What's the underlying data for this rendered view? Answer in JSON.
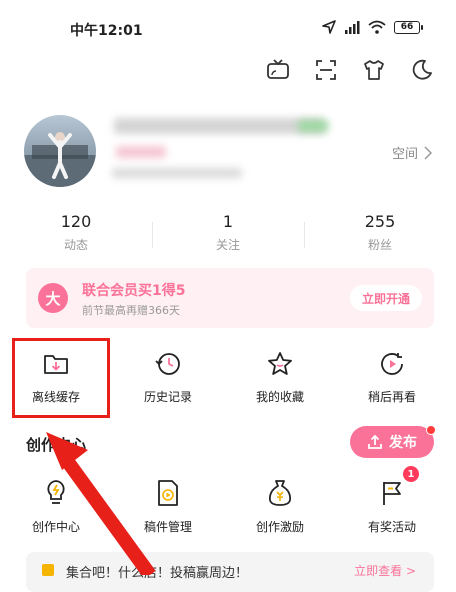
{
  "status_bar": {
    "time": "中午12:01",
    "battery": "66"
  },
  "profile": {
    "space_label": "空间"
  },
  "stats": [
    {
      "value": "120",
      "label": "动态"
    },
    {
      "value": "1",
      "label": "关注"
    },
    {
      "value": "255",
      "label": "粉丝"
    }
  ],
  "vip": {
    "badge": "大",
    "title": "联合会员买1得5",
    "subtitle": "前节最高再赠366天",
    "button": "立即开通"
  },
  "quick_actions": [
    {
      "label": "离线缓存",
      "icon": "offline-cache-icon"
    },
    {
      "label": "历史记录",
      "icon": "history-icon"
    },
    {
      "label": "我的收藏",
      "icon": "favorites-icon"
    },
    {
      "label": "稍后再看",
      "icon": "watch-later-icon"
    }
  ],
  "creation": {
    "title": "创作中心",
    "publish_label": "发布",
    "items": [
      {
        "label": "创作中心",
        "icon": "creation-center-icon"
      },
      {
        "label": "稿件管理",
        "icon": "manuscript-manage-icon"
      },
      {
        "label": "创作激励",
        "icon": "creation-incentive-icon"
      },
      {
        "label": "有奖活动",
        "icon": "reward-activity-icon",
        "badge": "1"
      }
    ]
  },
  "bottom_banner": {
    "text": "集合吧！什么店！投稿赢周边！",
    "more": "立即查看 >"
  },
  "colors": {
    "accent": "#fb7299",
    "highlight_red": "#e8201a"
  }
}
